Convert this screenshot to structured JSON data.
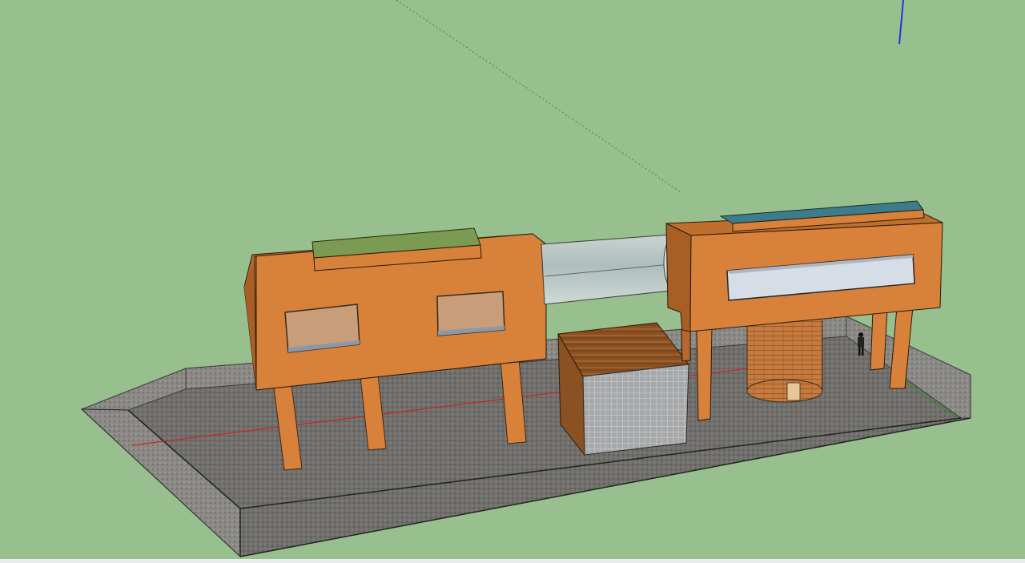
{
  "app": {
    "kind": "3D modeling viewport"
  },
  "scene": {
    "background_color": "#98bf8e",
    "objects": [
      "ground-platform",
      "left-building",
      "right-building",
      "glass-tube-bridge",
      "wooden-cube",
      "brick-cylinder-silo",
      "human-figure"
    ],
    "axes": {
      "red": "#d02020",
      "green": "#2a8f2a",
      "blue": "#2535e0"
    },
    "colors": {
      "wall_orange": "#d7813a",
      "wall_orange_dark": "#b8682a",
      "ground": "#6f6e6b",
      "glass": "#b9c6c4",
      "roof_green": "#7b9a52",
      "roof_blue": "#3d7c8a"
    }
  }
}
